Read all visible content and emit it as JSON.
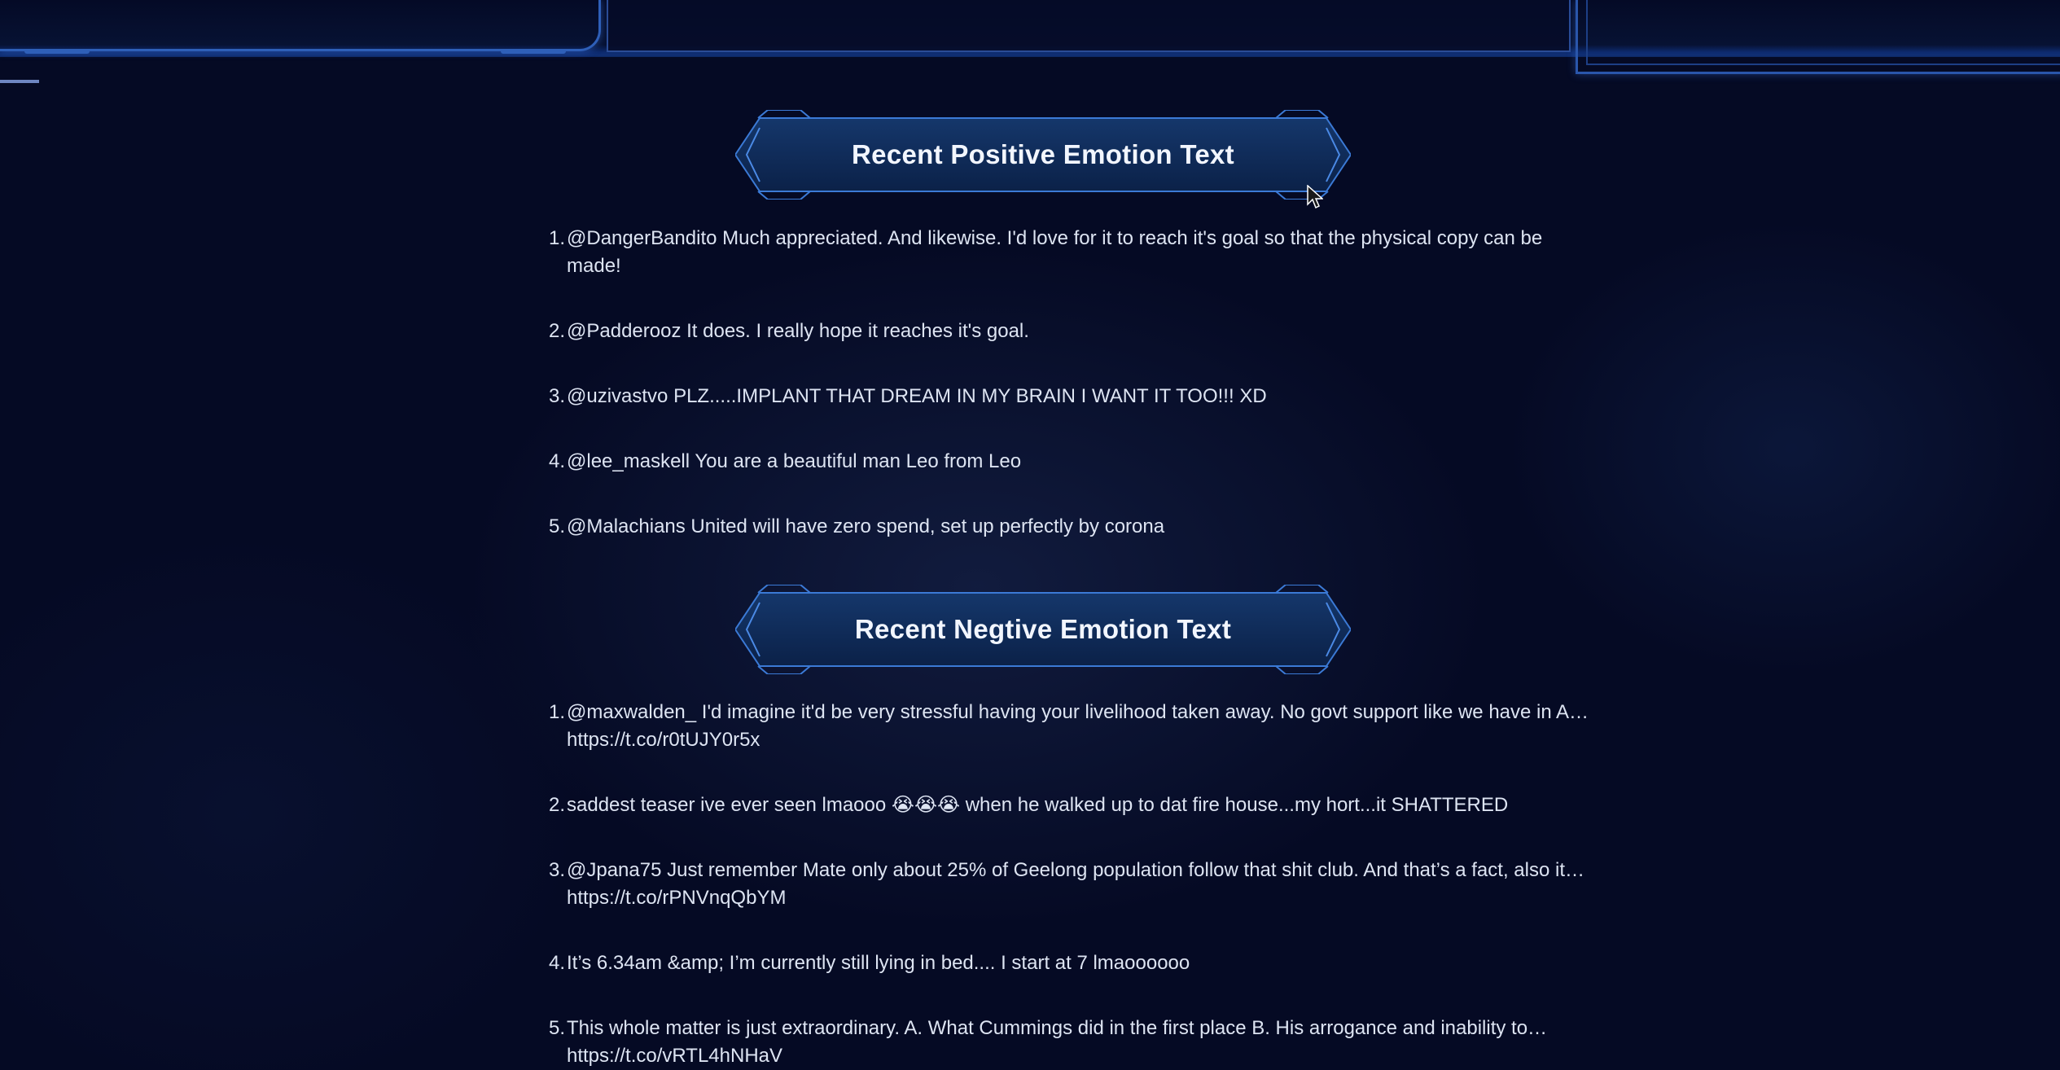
{
  "positive": {
    "title": "Recent Positive Emotion Text",
    "items": [
      {
        "num": "1.",
        "text": "@DangerBandito Much appreciated. And likewise. I'd love for it to reach it's goal so that the physical copy can be made!"
      },
      {
        "num": "2.",
        "text": "@Padderooz It does. I really hope it reaches it's goal."
      },
      {
        "num": "3.",
        "text": "@uzivastvo PLZ.....IMPLANT THAT DREAM IN MY BRAIN I WANT IT TOO!!! XD"
      },
      {
        "num": "4.",
        "text": "@lee_maskell You are a beautiful man Leo from Leo"
      },
      {
        "num": "5.",
        "text": "@Malachians United will have zero spend, set up perfectly by corona"
      }
    ]
  },
  "negative": {
    "title": "Recent Negtive Emotion Text",
    "items": [
      {
        "num": "1.",
        "text": "@maxwalden_ I'd imagine it'd be very stressful having your livelihood taken away. No govt support like we have in A… https://t.co/r0tUJY0r5x"
      },
      {
        "num": "2.",
        "text": "saddest teaser ive ever seen lmaooo 😭😭😭 when he walked up to dat fire house...my hort...it SHATTERED"
      },
      {
        "num": "3.",
        "text": "@Jpana75 Just remember Mate only about 25% of Geelong population follow that shit club. And that’s a fact, also it… https://t.co/rPNVnqQbYM"
      },
      {
        "num": "4.",
        "text": "It’s 6.34am &amp; I’m currently still lying in bed.... I start at 7 lmaoooooo"
      },
      {
        "num": "5.",
        "text": "This whole matter is just extraordinary. A. What Cummings did in the first place B. His arrogance and inability to… https://t.co/vRTL4hNHaV"
      }
    ]
  },
  "colors": {
    "background": "#050a24",
    "frame_blue": "#2e5fb8",
    "header_fill": "#0e2a55",
    "text": "#dde4f2"
  }
}
